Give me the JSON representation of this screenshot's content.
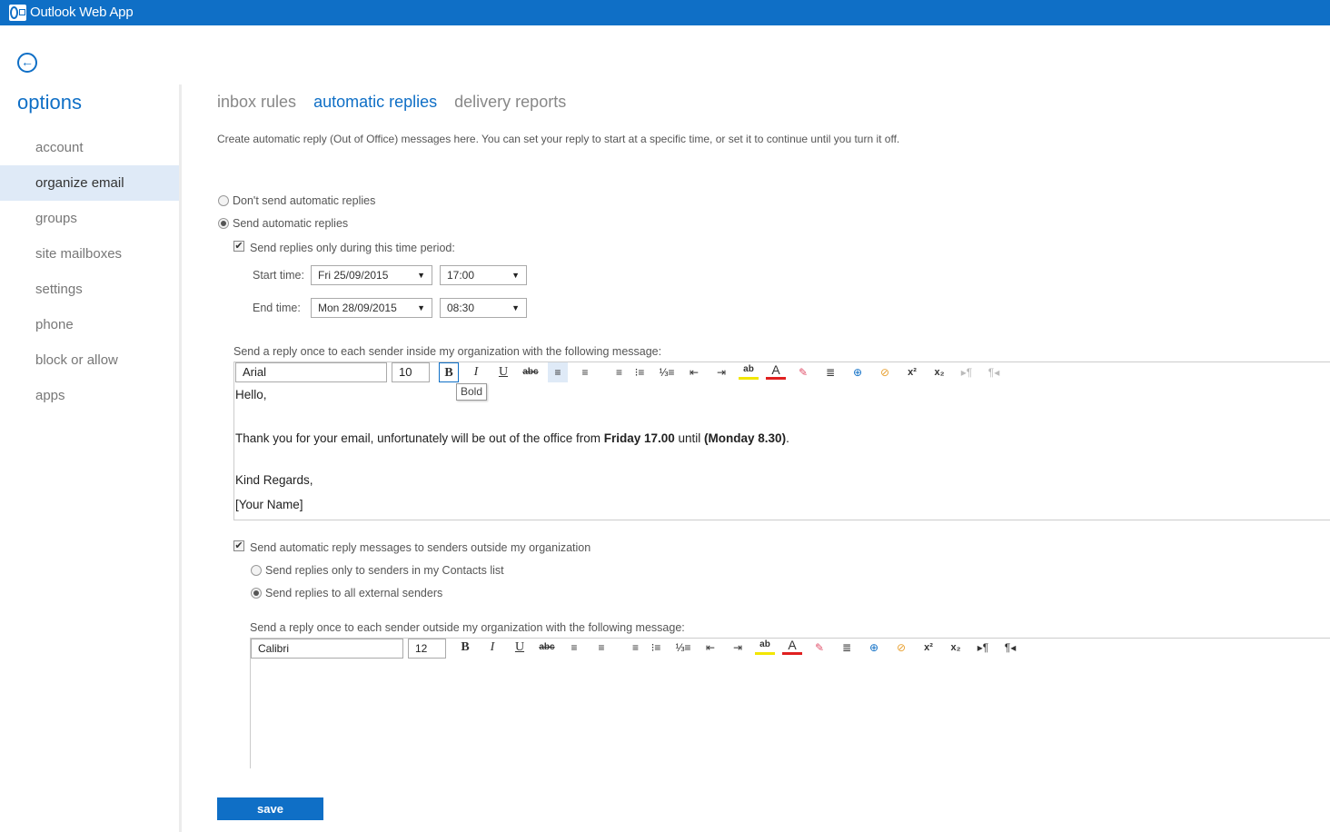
{
  "app": {
    "title": "Outlook Web App"
  },
  "sidebar": {
    "title": "options",
    "items": [
      {
        "label": "account"
      },
      {
        "label": "organize email"
      },
      {
        "label": "groups"
      },
      {
        "label": "site mailboxes"
      },
      {
        "label": "settings"
      },
      {
        "label": "phone"
      },
      {
        "label": "block or allow"
      },
      {
        "label": "apps"
      }
    ],
    "active": "organize email"
  },
  "tabs": [
    {
      "label": "inbox rules"
    },
    {
      "label": "automatic replies"
    },
    {
      "label": "delivery reports"
    }
  ],
  "description": "Create automatic reply (Out of Office) messages here. You can set your reply to start at a specific time, or set it to continue until you turn it off.",
  "options": {
    "dont_send": "Don't send automatic replies",
    "send": "Send automatic replies",
    "selected": "send",
    "time_period_label": "Send replies only during this time period:",
    "time_period_checked": true
  },
  "times": {
    "start_label": "Start time:",
    "start_date": "Fri 25/09/2015",
    "start_time": "17:00",
    "end_label": "End time:",
    "end_date": "Mon 28/09/2015",
    "end_time": "08:30"
  },
  "inside": {
    "label": "Send a reply once to each sender inside my organization with the following message:",
    "font": "Arial",
    "size": "10",
    "tooltip": "Bold",
    "message": {
      "line1": "Hello,",
      "line2_a": "Thank you for your email, unfortunately will be out of the office from ",
      "line2_b": "Friday 17.00",
      "line2_c": " until ",
      "line2_d": "(Monday 8.30)",
      "line2_e": ".",
      "line3": "Kind Regards,",
      "line4": "[Your Name]"
    }
  },
  "outside": {
    "checkbox_label": "Send automatic reply messages to senders outside my organization",
    "checked": true,
    "contacts_only": "Send replies only to senders in my Contacts list",
    "all_external": "Send replies to all external senders",
    "selected": "all_external",
    "label": "Send a reply once to each sender outside my organization with the following message:",
    "font": "Calibri",
    "size": "12"
  },
  "toolbar_icons": [
    "bold",
    "italic",
    "underline",
    "strikethrough",
    "align-left",
    "align-center",
    "align-right",
    "bullets",
    "numbering",
    "decrease-indent",
    "increase-indent",
    "highlight",
    "font-color",
    "clear-formatting",
    "paragraph-spacing",
    "insert-link",
    "remove-link",
    "superscript",
    "subscript",
    "ltr",
    "rtl"
  ],
  "save_label": "save",
  "colors": {
    "accent": "#0f6fc6",
    "active_nav": "#dfeaf7"
  }
}
